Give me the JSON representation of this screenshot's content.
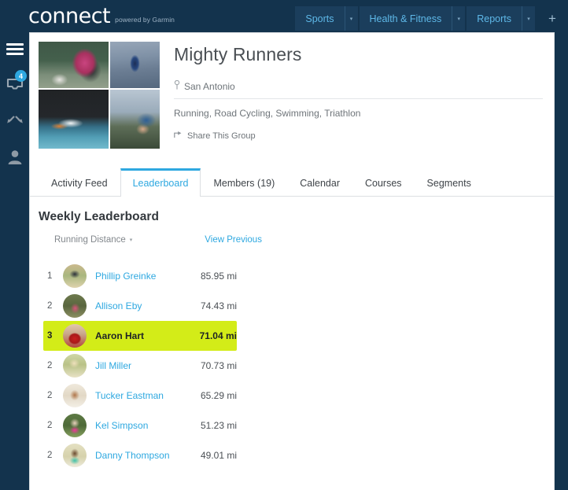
{
  "brand": {
    "name": "connect",
    "tagline": "powered by Garmin"
  },
  "topnav": {
    "items": [
      {
        "label": "Sports",
        "caret": "▾"
      },
      {
        "label": "Health & Fitness",
        "caret": "▾"
      },
      {
        "label": "Reports",
        "caret": "▾"
      }
    ],
    "add_label": "+"
  },
  "rail": {
    "menu_icon": "hamburger-menu-icon",
    "inbox_icon": "inbox-tray-icon",
    "inbox_badge": "4",
    "connections_icon": "connections-arrows-icon",
    "profile_icon": "person-icon"
  },
  "group": {
    "title": "Mighty Runners",
    "location": "San Antonio",
    "location_icon": "map-pin-icon",
    "activities": "Running, Road Cycling, Swimming, Triathlon",
    "share_label": "Share This Group",
    "share_icon": "share-arrow-icon",
    "photos": [
      {
        "name": "runner-photo",
        "alt": "Runner seated stretching"
      },
      {
        "name": "cyclist-photo",
        "alt": "Cyclist on road"
      },
      {
        "name": "swimmer-photo",
        "alt": "Swimmer in water"
      },
      {
        "name": "mountain-biker-photo",
        "alt": "Mountain biker with helmet"
      }
    ]
  },
  "tabs": [
    {
      "label": "Activity Feed",
      "active": false
    },
    {
      "label": "Leaderboard",
      "active": true
    },
    {
      "label": "Members (19)",
      "active": false
    },
    {
      "label": "Calendar",
      "active": false
    },
    {
      "label": "Courses",
      "active": false
    },
    {
      "label": "Segments",
      "active": false
    }
  ],
  "leaderboard": {
    "title": "Weekly Leaderboard",
    "metric_label": "Running Distance",
    "metric_caret": "▾",
    "view_previous_label": "View Previous",
    "highlight_color": "#d3ec18",
    "accent_color": "#2ea8e0",
    "rows": [
      {
        "rank": "1",
        "name": "Phillip Greinke",
        "distance": "85.95 mi",
        "highlighted": false
      },
      {
        "rank": "2",
        "name": "Allison Eby",
        "distance": "74.43 mi",
        "highlighted": false
      },
      {
        "rank": "3",
        "name": "Aaron Hart",
        "distance": "71.04 mi",
        "highlighted": true
      },
      {
        "rank": "2",
        "name": "Jill Miller",
        "distance": "70.73 mi",
        "highlighted": false
      },
      {
        "rank": "2",
        "name": "Tucker Eastman",
        "distance": "65.29 mi",
        "highlighted": false
      },
      {
        "rank": "2",
        "name": "Kel Simpson",
        "distance": "51.23 mi",
        "highlighted": false
      },
      {
        "rank": "2",
        "name": "Danny Thompson",
        "distance": "49.01 mi",
        "highlighted": false
      }
    ]
  }
}
